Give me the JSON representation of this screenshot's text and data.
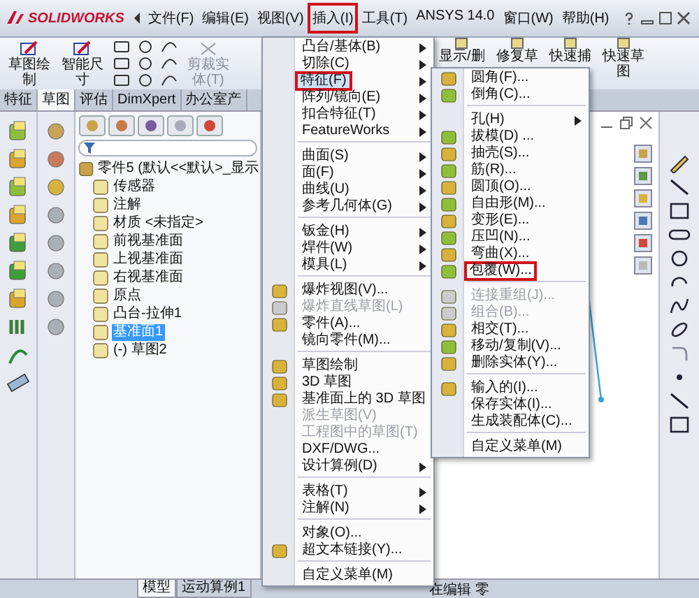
{
  "app": {
    "logo": "SOLIDWORKS"
  },
  "menu_bar": [
    {
      "label": "文件(F)",
      "marked": false
    },
    {
      "label": "编辑(E)",
      "marked": false
    },
    {
      "label": "视图(V)",
      "marked": false
    },
    {
      "label": "插入(I)",
      "marked": true
    },
    {
      "label": "工具(T)",
      "marked": false
    },
    {
      "label": "ANSYS 14.0",
      "marked": false
    },
    {
      "label": "窗口(W)",
      "marked": false
    },
    {
      "label": "帮助(H)",
      "marked": false
    }
  ],
  "ribbon": [
    {
      "label": "草图绘制",
      "disabled": false
    },
    {
      "label": "智能尺寸",
      "disabled": false
    },
    {
      "label": "剪裁实体(T)",
      "disabled": true
    },
    {
      "label": "显示/删",
      "disabled": false
    },
    {
      "label": "修复草",
      "disabled": false
    },
    {
      "label": "快速捕",
      "disabled": false
    },
    {
      "label": "快速草图",
      "disabled": false
    }
  ],
  "ribbon_tabs": [
    {
      "label": "特征",
      "selected": false
    },
    {
      "label": "草图",
      "selected": true
    },
    {
      "label": "评估",
      "selected": false
    },
    {
      "label": "DimXpert",
      "selected": false
    },
    {
      "label": "办公室产",
      "selected": false
    }
  ],
  "tree": [
    {
      "label": "零件5 (默认<<默认>_显示",
      "selected": false,
      "children": [
        {
          "label": "传感器",
          "selected": false
        },
        {
          "label": "注解",
          "selected": false
        },
        {
          "label": "材质 <未指定>",
          "selected": false
        },
        {
          "label": "前视基准面",
          "selected": false
        },
        {
          "label": "上视基准面",
          "selected": false
        },
        {
          "label": "右视基准面",
          "selected": false
        },
        {
          "label": "原点",
          "selected": false
        },
        {
          "label": "凸台-拉伸1",
          "selected": false
        },
        {
          "label": "基准面1",
          "selected": true
        },
        {
          "label": "(-) 草图2",
          "selected": false
        }
      ]
    }
  ],
  "insert_menu": [
    [
      {
        "label": "凸台/基体(B)",
        "submenu": true,
        "disabled": false,
        "selected": false,
        "marked": false,
        "has_icon": false
      },
      {
        "label": "切除(C)",
        "submenu": true,
        "disabled": false,
        "selected": false,
        "marked": false,
        "has_icon": false
      },
      {
        "label": "特征(F)",
        "submenu": true,
        "disabled": false,
        "selected": true,
        "marked": true,
        "has_icon": false
      },
      {
        "label": "阵列/镜向(E)",
        "submenu": true,
        "disabled": false,
        "selected": false,
        "marked": false,
        "has_icon": false
      },
      {
        "label": "扣合特征(T)",
        "submenu": true,
        "disabled": false,
        "selected": false,
        "marked": false,
        "has_icon": false
      },
      {
        "label": "FeatureWorks",
        "submenu": true,
        "disabled": false,
        "selected": false,
        "marked": false,
        "has_icon": false
      }
    ],
    [
      {
        "label": "曲面(S)",
        "submenu": true,
        "disabled": false,
        "selected": false,
        "marked": false,
        "has_icon": false
      },
      {
        "label": "面(F)",
        "submenu": true,
        "disabled": false,
        "selected": false,
        "marked": false,
        "has_icon": false
      },
      {
        "label": "曲线(U)",
        "submenu": true,
        "disabled": false,
        "selected": false,
        "marked": false,
        "has_icon": false
      },
      {
        "label": "参考几何体(G)",
        "submenu": true,
        "disabled": false,
        "selected": false,
        "marked": false,
        "has_icon": false
      }
    ],
    [
      {
        "label": "钣金(H)",
        "submenu": true,
        "disabled": false,
        "selected": false,
        "marked": false,
        "has_icon": false
      },
      {
        "label": "焊件(W)",
        "submenu": true,
        "disabled": false,
        "selected": false,
        "marked": false,
        "has_icon": false
      },
      {
        "label": "模具(L)",
        "submenu": true,
        "disabled": false,
        "selected": false,
        "marked": false,
        "has_icon": false
      }
    ],
    [
      {
        "label": "爆炸视图(V)...",
        "submenu": false,
        "disabled": false,
        "selected": false,
        "marked": false,
        "has_icon": true
      },
      {
        "label": "爆炸直线草图(L)",
        "submenu": false,
        "disabled": true,
        "selected": false,
        "marked": false,
        "has_icon": true
      },
      {
        "label": "零件(A)...",
        "submenu": false,
        "disabled": false,
        "selected": false,
        "marked": false,
        "has_icon": true
      },
      {
        "label": "镜向零件(M)...",
        "submenu": false,
        "disabled": false,
        "selected": false,
        "marked": false,
        "has_icon": false
      }
    ],
    [
      {
        "label": "草图绘制",
        "submenu": false,
        "disabled": false,
        "selected": false,
        "marked": false,
        "has_icon": true
      },
      {
        "label": "3D 草图",
        "submenu": false,
        "disabled": false,
        "selected": false,
        "marked": false,
        "has_icon": true
      },
      {
        "label": "基准面上的 3D 草图",
        "submenu": false,
        "disabled": false,
        "selected": false,
        "marked": false,
        "has_icon": true
      },
      {
        "label": "派生草图(V)",
        "submenu": false,
        "disabled": true,
        "selected": false,
        "marked": false,
        "has_icon": false
      },
      {
        "label": "工程图中的草图(T)",
        "submenu": false,
        "disabled": true,
        "selected": false,
        "marked": false,
        "has_icon": false
      },
      {
        "label": "DXF/DWG...",
        "submenu": false,
        "disabled": false,
        "selected": false,
        "marked": false,
        "has_icon": false
      },
      {
        "label": "设计算例(D)",
        "submenu": true,
        "disabled": false,
        "selected": false,
        "marked": false,
        "has_icon": false
      }
    ],
    [
      {
        "label": "表格(T)",
        "submenu": true,
        "disabled": false,
        "selected": false,
        "marked": false,
        "has_icon": false
      },
      {
        "label": "注解(N)",
        "submenu": true,
        "disabled": false,
        "selected": false,
        "marked": false,
        "has_icon": false
      }
    ],
    [
      {
        "label": "对象(O)...",
        "submenu": false,
        "disabled": false,
        "selected": false,
        "marked": false,
        "has_icon": false
      },
      {
        "label": "超文本链接(Y)...",
        "submenu": false,
        "disabled": false,
        "selected": false,
        "marked": false,
        "has_icon": true
      }
    ],
    [
      {
        "label": "自定义菜单(M)",
        "submenu": false,
        "disabled": false,
        "selected": false,
        "marked": false,
        "has_icon": false
      }
    ]
  ],
  "features_menu": [
    [
      {
        "label": "圆角(F)...",
        "submenu": false,
        "disabled": false,
        "marked": false,
        "has_icon": true
      },
      {
        "label": "倒角(C)...",
        "submenu": false,
        "disabled": false,
        "marked": false,
        "has_icon": true
      }
    ],
    [
      {
        "label": "孔(H)",
        "submenu": true,
        "disabled": false,
        "marked": false,
        "has_icon": false
      },
      {
        "label": "拔模(D) ...",
        "submenu": false,
        "disabled": false,
        "marked": false,
        "has_icon": true
      },
      {
        "label": "抽壳(S)...",
        "submenu": false,
        "disabled": false,
        "marked": false,
        "has_icon": true
      },
      {
        "label": "筋(R)...",
        "submenu": false,
        "disabled": false,
        "marked": false,
        "has_icon": true
      },
      {
        "label": "圆顶(O)...",
        "submenu": false,
        "disabled": false,
        "marked": false,
        "has_icon": true
      },
      {
        "label": "自由形(M)...",
        "submenu": false,
        "disabled": false,
        "marked": false,
        "has_icon": true
      },
      {
        "label": "变形(E)...",
        "submenu": false,
        "disabled": false,
        "marked": false,
        "has_icon": true
      },
      {
        "label": "压凹(N)...",
        "submenu": false,
        "disabled": false,
        "marked": false,
        "has_icon": true
      },
      {
        "label": "弯曲(X)...",
        "submenu": false,
        "disabled": false,
        "marked": false,
        "has_icon": true
      },
      {
        "label": "包覆(W)...",
        "submenu": false,
        "disabled": false,
        "marked": true,
        "has_icon": true
      }
    ],
    [
      {
        "label": "连接重组(J)...",
        "submenu": false,
        "disabled": true,
        "marked": false,
        "has_icon": true
      },
      {
        "label": "组合(B)...",
        "submenu": false,
        "disabled": true,
        "marked": false,
        "has_icon": true
      },
      {
        "label": "相交(T)...",
        "submenu": false,
        "disabled": false,
        "marked": false,
        "has_icon": true
      },
      {
        "label": "移动/复制(V)...",
        "submenu": false,
        "disabled": false,
        "marked": false,
        "has_icon": true
      },
      {
        "label": "删除实体(Y)...",
        "submenu": false,
        "disabled": false,
        "marked": false,
        "has_icon": true
      }
    ],
    [
      {
        "label": "输入的(I)...",
        "submenu": false,
        "disabled": false,
        "marked": false,
        "has_icon": true
      },
      {
        "label": "保存实体(I)...",
        "submenu": false,
        "disabled": false,
        "marked": false,
        "has_icon": false
      },
      {
        "label": "生成装配体(C)...",
        "submenu": false,
        "disabled": false,
        "marked": false,
        "has_icon": false
      }
    ],
    [
      {
        "label": "自定义菜单(M)",
        "submenu": false,
        "disabled": false,
        "marked": false,
        "has_icon": false
      }
    ]
  ],
  "bottom_tabs": [
    {
      "label": "模型",
      "selected": true
    },
    {
      "label": "运动算例1",
      "selected": false
    }
  ],
  "status_bar": {
    "text": "在编辑 零"
  }
}
